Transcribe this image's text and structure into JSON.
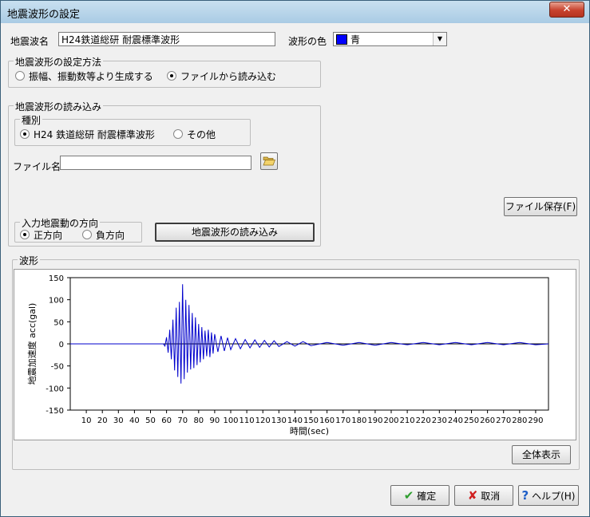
{
  "window": {
    "title": "地震波形の設定",
    "close_label": "✕"
  },
  "wave_name": {
    "label": "地震波名",
    "value": "H24鉄道総研 耐震標準波形"
  },
  "wave_color": {
    "label": "波形の色",
    "value": "青",
    "color": "#0000ff"
  },
  "method_group": {
    "title": "地震波形の設定方法",
    "options": [
      "振幅、振動数等より生成する",
      "ファイルから読み込む"
    ],
    "selected_index": 1
  },
  "load_group": {
    "title": "地震波形の読み込み",
    "kind": {
      "title": "種別",
      "options": [
        "H24 鉄道総研 耐震標準波形",
        "その他"
      ],
      "selected_index": 0
    },
    "file_label": "ファイル名",
    "file_value": "",
    "direction": {
      "title": "入力地震動の方向",
      "options": [
        "正方向",
        "負方向"
      ],
      "selected_index": 0
    },
    "load_button": "地震波形の読み込み"
  },
  "save_file_button": "ファイル保存(F)",
  "waveform_group": {
    "title": "波形"
  },
  "show_all_button": "全体表示",
  "ok_button": "確定",
  "cancel_button": "取消",
  "help_button": "ヘルプ(H)",
  "chart_data": {
    "type": "line",
    "ylabel": "地震加速度 acc(gal)",
    "xlabel": "時間(sec)",
    "ylim": [
      -150,
      150
    ],
    "xlim": [
      0,
      298
    ],
    "yticks": [
      150,
      100,
      50,
      0,
      -50,
      -100,
      -150
    ],
    "xticks": [
      10,
      20,
      30,
      40,
      50,
      60,
      70,
      80,
      90,
      100,
      110,
      120,
      130,
      140,
      150,
      160,
      170,
      180,
      190,
      200,
      210,
      220,
      230,
      240,
      250,
      260,
      270,
      280,
      290
    ],
    "grid": false,
    "series": [
      {
        "color": "#0000cc",
        "x": [
          0,
          58,
          59,
          60,
          61,
          62,
          63,
          64,
          65,
          66,
          67,
          68,
          69,
          70,
          71,
          72,
          73,
          74,
          75,
          76,
          77,
          78,
          79,
          80,
          81,
          82,
          83,
          84,
          85,
          86,
          87,
          88,
          89,
          90,
          92,
          94,
          96,
          98,
          100,
          103,
          106,
          109,
          112,
          115,
          118,
          121,
          124,
          127,
          130,
          135,
          140,
          145,
          150,
          160,
          170,
          180,
          190,
          200,
          210,
          220,
          230,
          240,
          250,
          260,
          270,
          280,
          290,
          298
        ],
        "y": [
          0,
          0,
          -5,
          15,
          -20,
          32,
          -35,
          55,
          -60,
          82,
          -75,
          95,
          -90,
          135,
          -80,
          100,
          -65,
          88,
          -58,
          70,
          -55,
          60,
          -48,
          45,
          -42,
          38,
          -35,
          30,
          -28,
          32,
          -30,
          26,
          -22,
          22,
          -18,
          18,
          -16,
          14,
          -13,
          12,
          -11,
          10,
          -9,
          9,
          -8,
          8,
          -7,
          7,
          -6,
          5,
          -5,
          5,
          -4,
          3,
          -3,
          3,
          -3,
          3,
          -2,
          3,
          -2,
          3,
          -2,
          3,
          -2,
          3,
          -2,
          0
        ]
      }
    ]
  }
}
